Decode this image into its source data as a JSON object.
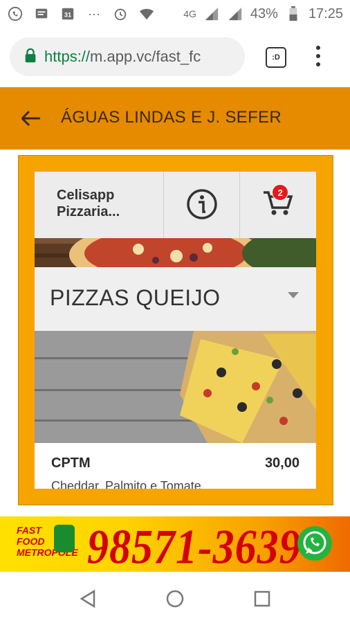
{
  "status_bar": {
    "network": "4G",
    "battery": "43%",
    "time": "17:25",
    "icons": [
      "whatsapp-icon",
      "message-icon",
      "calendar-icon",
      "more-icon",
      "alarm-icon",
      "wifi-icon",
      "signal-icon",
      "signal-icon",
      "battery-icon"
    ],
    "calendar_day": "31",
    "more": "···"
  },
  "browser": {
    "url_scheme": "https://",
    "url_rest": "m.app.vc/fast_fc",
    "tabs_label": ":D"
  },
  "app_bar": {
    "title": "ÁGUAS LINDAS E J. SEFER",
    "accent": "#e68a00"
  },
  "shop": {
    "name_line1": "Celisapp",
    "name_line2": "Pizzaria...",
    "cart_count": "2"
  },
  "category": {
    "selected": "PIZZAS QUEIJO"
  },
  "product": {
    "name": "CPTM",
    "price": "30,00",
    "description": "Cheddar, Palmito e Tomate"
  },
  "banner": {
    "fast_food_lines": [
      "FAST",
      "FOOD",
      "METROPOLE"
    ],
    "phone": "98571-3639",
    "colors": {
      "primary": "#ffd400",
      "phone": "#d40000"
    }
  },
  "nav": {
    "icons": [
      "back-icon",
      "home-icon",
      "recents-icon"
    ]
  },
  "colors": {
    "frame": "#f5a400",
    "app_bar": "#e68a00"
  }
}
